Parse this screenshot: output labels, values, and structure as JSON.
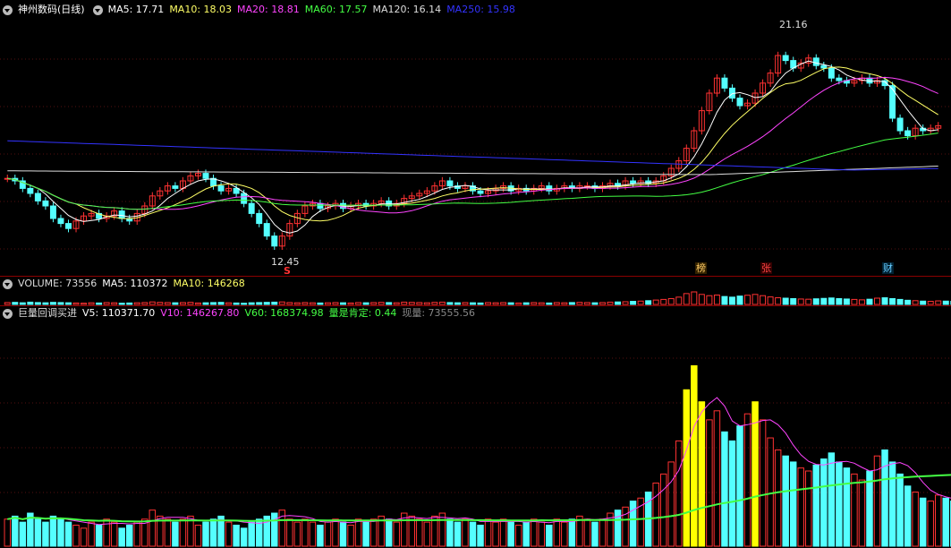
{
  "price_legend": {
    "stock": "神州数码(日线)",
    "ma5": "MA5: 17.71",
    "ma10": "MA10: 18.03",
    "ma20": "MA20: 18.81",
    "ma60": "MA60: 17.57",
    "ma120": "MA120: 16.14",
    "ma250": "MA250: 15.98"
  },
  "price_annotations": {
    "high": "21.16",
    "low": "12.45",
    "low_marker": "S",
    "tag_bang": "榜",
    "tag_zhang": "张",
    "tag_cai": "财"
  },
  "volume_legend": {
    "volume": "VOLUME: 73556",
    "ma5": "MA5: 110372",
    "ma10": "MA10: 146268"
  },
  "indicator_legend": {
    "name": "巨量回调买进",
    "v5": "V5: 110371.70",
    "v10": "V10: 146267.80",
    "v60": "V60: 168374.98",
    "ratio": "量是肯定: 0.44",
    "current": "现量: 73555.56"
  },
  "colors": {
    "up": "#ff3232",
    "down": "#54ffff",
    "ma5": "#ffffff",
    "ma10": "#ffff66",
    "ma20": "#ff44ff",
    "ma60": "#44ff44",
    "ma120": "#dddddd",
    "ma250": "#3333ff",
    "separator": "#8b0000"
  },
  "chart_data": {
    "type": "candlestick",
    "price_range": [
      12,
      22
    ],
    "high_marked": 21.16,
    "low_marked": 12.45,
    "ma_last": {
      "MA5": 17.71,
      "MA10": 18.03,
      "MA20": 18.81,
      "MA60": 17.57,
      "MA120": 16.14,
      "MA250": 15.98
    },
    "volume_last": 73556,
    "volume_ma5": 110372,
    "volume_ma10": 146268,
    "v5": 110371.7,
    "v10": 146267.8,
    "v60": 168374.98,
    "ratio": 0.44,
    "current_volume": 73555.56,
    "closes": [
      15.6,
      15.5,
      15.2,
      15.0,
      14.7,
      14.5,
      14.0,
      13.8,
      13.6,
      13.9,
      14.1,
      14.2,
      14.0,
      14.1,
      14.3,
      14.0,
      13.9,
      14.2,
      14.5,
      14.9,
      15.1,
      15.3,
      15.2,
      15.5,
      15.7,
      15.8,
      15.6,
      15.3,
      15.1,
      15.2,
      15.0,
      14.6,
      14.2,
      13.8,
      13.3,
      12.9,
      13.3,
      13.8,
      14.2,
      14.5,
      14.6,
      14.4,
      14.5,
      14.6,
      14.4,
      14.5,
      14.6,
      14.5,
      14.6,
      14.7,
      14.5,
      14.6,
      14.8,
      14.9,
      15.0,
      15.1,
      15.3,
      15.5,
      15.3,
      15.2,
      15.3,
      15.1,
      15.0,
      15.1,
      15.2,
      15.3,
      15.1,
      15.2,
      15.1,
      15.2,
      15.3,
      15.1,
      15.2,
      15.3,
      15.2,
      15.3,
      15.3,
      15.2,
      15.3,
      15.4,
      15.3,
      15.5,
      15.4,
      15.5,
      15.4,
      15.5,
      15.7,
      16.0,
      16.3,
      16.8,
      17.5,
      18.3,
      19.0,
      19.6,
      19.2,
      18.8,
      18.5,
      18.6,
      19.0,
      19.4,
      19.8,
      20.5,
      20.3,
      20.0,
      20.2,
      20.4,
      20.1,
      20.0,
      19.6,
      19.5,
      19.4,
      19.5,
      19.6,
      19.4,
      19.5,
      19.3,
      18.0,
      17.5,
      17.3,
      17.6,
      17.5,
      17.6,
      17.7
    ],
    "volumes": [
      9,
      10,
      8,
      11,
      9,
      8,
      10,
      9,
      8,
      7,
      6,
      8,
      7,
      9,
      8,
      6,
      7,
      8,
      9,
      12,
      10,
      9,
      8,
      9,
      10,
      7,
      8,
      9,
      10,
      8,
      7,
      6,
      8,
      9,
      10,
      11,
      12,
      9,
      8,
      9,
      8,
      7,
      8,
      9,
      8,
      7,
      9,
      8,
      9,
      10,
      9,
      8,
      11,
      10,
      9,
      8,
      10,
      11,
      9,
      8,
      9,
      8,
      7,
      9,
      8,
      9,
      8,
      7,
      8,
      9,
      8,
      7,
      9,
      8,
      9,
      10,
      9,
      8,
      9,
      11,
      12,
      13,
      15,
      16,
      18,
      21,
      24,
      28,
      35,
      52,
      60,
      48,
      42,
      45,
      38,
      35,
      40,
      44,
      48,
      42,
      36,
      32,
      30,
      28,
      26,
      25,
      27,
      29,
      31,
      28,
      26,
      24,
      22,
      25,
      30,
      32,
      28,
      24,
      20,
      18,
      16,
      15,
      17,
      16,
      15,
      14
    ]
  }
}
